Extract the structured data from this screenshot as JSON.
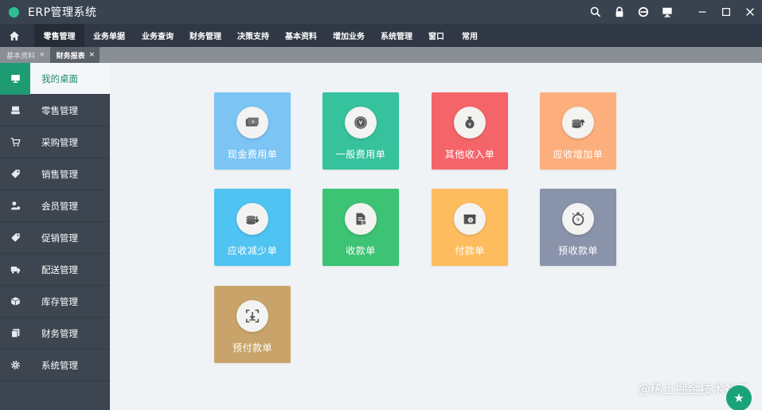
{
  "app": {
    "title": "ERP管理系统"
  },
  "menu": {
    "items": [
      {
        "label": "零售管理",
        "active": true
      },
      {
        "label": "业务单据"
      },
      {
        "label": "业务查询"
      },
      {
        "label": "财务管理"
      },
      {
        "label": "决策支持"
      },
      {
        "label": "基本资料"
      },
      {
        "label": "增加业务"
      },
      {
        "label": "系统管理"
      },
      {
        "label": "窗口"
      },
      {
        "label": "常用"
      }
    ]
  },
  "tabs": [
    {
      "label": "基本资料",
      "close": "×"
    },
    {
      "label": "财务报表",
      "close": "×",
      "active": true
    }
  ],
  "sidebar": {
    "items": [
      {
        "label": "我的桌面",
        "icon": "desktop-icon",
        "active": true
      },
      {
        "label": "零售管理",
        "icon": "register-icon"
      },
      {
        "label": "采购管理",
        "icon": "cart-icon"
      },
      {
        "label": "销售管理",
        "icon": "tag-icon"
      },
      {
        "label": "会员管理",
        "icon": "member-icon"
      },
      {
        "label": "促销管理",
        "icon": "promo-tag-icon"
      },
      {
        "label": "配送管理",
        "icon": "truck-icon"
      },
      {
        "label": "库存管理",
        "icon": "box-icon"
      },
      {
        "label": "财务管理",
        "icon": "document-icon"
      },
      {
        "label": "系统管理",
        "icon": "gear-icon"
      }
    ]
  },
  "tiles": [
    {
      "label": "现金费用单",
      "color": "#7cc4f4",
      "icon": "cash-icon"
    },
    {
      "label": "一般费用单",
      "color": "#36c29c",
      "icon": "coin-icon"
    },
    {
      "label": "其他收入单",
      "color": "#f4656a",
      "icon": "money-bag-icon"
    },
    {
      "label": "应收增加单",
      "color": "#fcae7d",
      "icon": "coins-up-icon"
    },
    {
      "label": "应收减少单",
      "color": "#4fc3f2",
      "icon": "coins-down-icon"
    },
    {
      "label": "收款单",
      "color": "#3cc373",
      "icon": "receipt-icon"
    },
    {
      "label": "付款单",
      "color": "#fdbd5e",
      "icon": "wallet-icon"
    },
    {
      "label": "预收款单",
      "color": "#8993aa",
      "icon": "stopwatch-icon"
    },
    {
      "label": "预付款单",
      "color": "#c9a46a",
      "icon": "scan-icon"
    }
  ],
  "watermark": "@稀土掘金技术社区",
  "fab": {
    "icon": "star-icon",
    "symbol": "★"
  }
}
